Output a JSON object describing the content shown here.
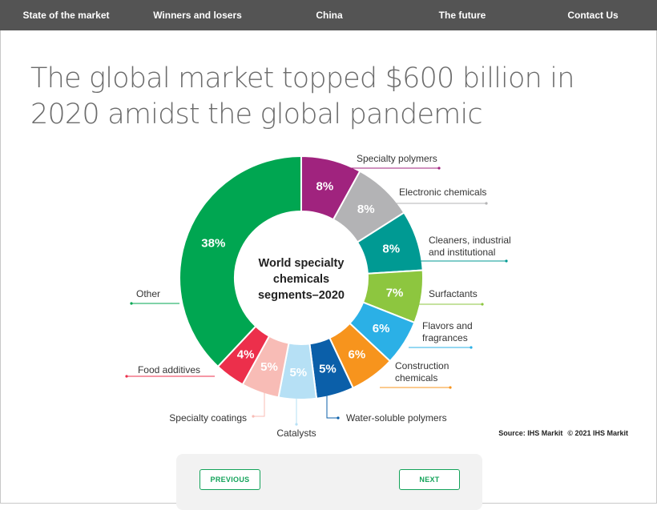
{
  "nav": {
    "items": [
      {
        "label": "State of the market",
        "active": true
      },
      {
        "label": "Winners and losers",
        "active": false
      },
      {
        "label": "China",
        "active": false
      },
      {
        "label": "The future",
        "active": false
      },
      {
        "label": "Contact Us",
        "active": false
      }
    ],
    "active_color": "#00a36c",
    "bar_color": "#545454"
  },
  "page_title": "The global market topped $600 billion in 2020 amidst the global pandemic",
  "source": {
    "text": "Source: IHS Markit",
    "copyright": "© 2021 IHS Markit"
  },
  "pager": {
    "previous_label": "PREVIOUS",
    "next_label": "NEXT",
    "accent_color": "#13a35a"
  },
  "chart_data": {
    "type": "pie",
    "donut": true,
    "title": "World specialty chemicals segments–2020",
    "title_lines": [
      "World specialty",
      "chemicals",
      "segments–2020"
    ],
    "slices": [
      {
        "label": "Specialty polymers",
        "value": 8,
        "display": "8%",
        "color": "#a0237e"
      },
      {
        "label": "Electronic chemicals",
        "value": 8,
        "display": "8%",
        "color": "#b3b3b5"
      },
      {
        "label": "Cleaners, industrial and institutional",
        "label_lines": [
          "Cleaners, industrial",
          "and institutional"
        ],
        "value": 8,
        "display": "8%",
        "color": "#009a93"
      },
      {
        "label": "Surfactants",
        "value": 7,
        "display": "7%",
        "color": "#8dc63f"
      },
      {
        "label": "Flavors and fragrances",
        "label_lines": [
          "Flavors and",
          "fragrances"
        ],
        "value": 6,
        "display": "6%",
        "color": "#2bb0e6"
      },
      {
        "label": "Construction chemicals",
        "label_lines": [
          "Construction",
          "chemicals"
        ],
        "value": 6,
        "display": "6%",
        "color": "#f7941d"
      },
      {
        "label": "Water-soluble polymers",
        "value": 5,
        "display": "5%",
        "color": "#0b5fa9"
      },
      {
        "label": "Catalysts",
        "value": 5,
        "display": "5%",
        "color": "#b6e0f5"
      },
      {
        "label": "Specialty coatings",
        "value": 5,
        "display": "5%",
        "color": "#f8bcb6"
      },
      {
        "label": "Food additives",
        "value": 4,
        "display": "4%",
        "color": "#ec2f4b"
      },
      {
        "label": "Other",
        "value": 38,
        "display": "38%",
        "color": "#00a651"
      }
    ]
  }
}
